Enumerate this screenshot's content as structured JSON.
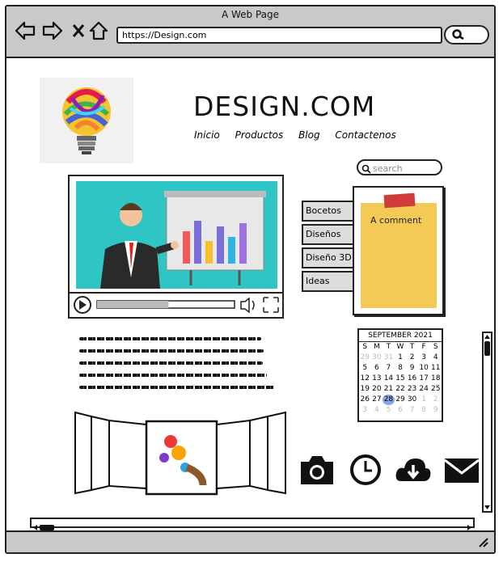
{
  "window": {
    "title": "A Web Page"
  },
  "browser": {
    "url": "https://Design.com"
  },
  "site": {
    "title": "DESIGN.COM",
    "nav": [
      "Inicio",
      "Productos",
      "Blog",
      "Contactenos"
    ]
  },
  "search": {
    "placeholder": "search"
  },
  "tabs": [
    "Bocetos",
    "Diseños",
    "Diseño 3D",
    "Ideas"
  ],
  "sticky_note": {
    "text": "A comment"
  },
  "calendar": {
    "month": "SEPTEMBER 2021",
    "weekdays": [
      "S",
      "M",
      "T",
      "W",
      "T",
      "F",
      "S"
    ],
    "days": [
      "29",
      "30",
      "31",
      "1",
      "2",
      "3",
      "4",
      "5",
      "6",
      "7",
      "8",
      "9",
      "10",
      "11",
      "12",
      "13",
      "14",
      "15",
      "16",
      "17",
      "18",
      "19",
      "20",
      "21",
      "22",
      "23",
      "24",
      "25",
      "26",
      "27",
      "28",
      "29",
      "30",
      "1",
      "2",
      "3",
      "4",
      "5",
      "6",
      "7",
      "8",
      "9"
    ],
    "selected": "28"
  },
  "video": {
    "progress": 0.52
  },
  "icons": [
    "camera-icon",
    "clock-icon",
    "cloud-download-icon",
    "mail-icon"
  ]
}
